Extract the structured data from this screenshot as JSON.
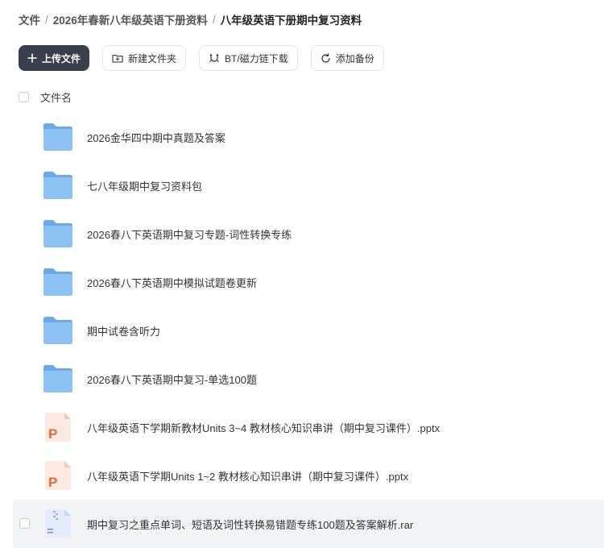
{
  "breadcrumb": [
    {
      "label": "文件"
    },
    {
      "label": "2026年春新八年级英语下册资料"
    },
    {
      "label": "八年级英语下册期中复习资料"
    }
  ],
  "breadcrumb_separator": "/",
  "toolbar": {
    "upload_label": "上传文件",
    "new_folder_label": "新建文件夹",
    "bt_download_label": "BT/磁力链下载",
    "add_backup_label": "添加备份"
  },
  "list_header": {
    "name_label": "文件名"
  },
  "files": [
    {
      "name": "2026金华四中期中真题及答案",
      "icon": "folder-icon"
    },
    {
      "name": "七八年级期中复习资料包",
      "icon": "folder-icon"
    },
    {
      "name": "2026春八下英语期中复习专题-词性转换专练",
      "icon": "folder-icon"
    },
    {
      "name": "2026春八下英语期中模拟试题卷更新",
      "icon": "folder-icon"
    },
    {
      "name": "期中试卷含听力",
      "icon": "folder-icon"
    },
    {
      "name": "2026春八下英语期中复习-单选100题",
      "icon": "folder-icon"
    },
    {
      "name": "八年级英语下学期新教材Units 3~4 教材核心知识串讲（期中复习课件）.pptx",
      "icon": "pptx-icon"
    },
    {
      "name": "八年级英语下学期Units 1~2 教材核心知识串讲（期中复习课件）.pptx",
      "icon": "pptx-icon"
    },
    {
      "name": "期中复习之重点单词、短语及词性转换易错题专练100题及答案解析.rar",
      "icon": "rar-icon"
    }
  ],
  "colors": {
    "folder": "#7fb8f0",
    "pptx": "#e06a3b",
    "primary_button": "#3b3f4c"
  }
}
